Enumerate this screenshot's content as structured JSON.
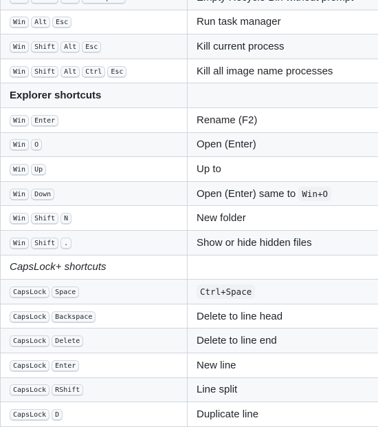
{
  "rows": [
    {
      "keys": [
        "Win",
        "Shift",
        "Alt",
        "Backspace"
      ],
      "desc": "Empty Recycle Bin without prompt"
    },
    {
      "keys": [
        "Win",
        "Alt",
        "Esc"
      ],
      "desc": "Run task manager"
    },
    {
      "keys": [
        "Win",
        "Shift",
        "Alt",
        "Esc"
      ],
      "desc": "Kill current process"
    },
    {
      "keys": [
        "Win",
        "Shift",
        "Alt",
        "Ctrl",
        "Esc"
      ],
      "desc": "Kill all image name processes"
    },
    {
      "section": "Explorer shortcuts",
      "style": "bold"
    },
    {
      "keys": [
        "Win",
        "Enter"
      ],
      "desc": "Rename (F2)"
    },
    {
      "keys": [
        "Win",
        "O"
      ],
      "desc": "Open (Enter)"
    },
    {
      "keys": [
        "Win",
        "Up"
      ],
      "desc": "Up to"
    },
    {
      "keys": [
        "Win",
        "Down"
      ],
      "desc": "Open (Enter) same to ",
      "code": "Win+O"
    },
    {
      "keys": [
        "Win",
        "Shift",
        "N"
      ],
      "desc": "New folder"
    },
    {
      "keys": [
        "Win",
        "Shift",
        "."
      ],
      "desc": "Show or hide hidden files"
    },
    {
      "section": "CapsLock+ shortcuts",
      "style": "italic"
    },
    {
      "keys": [
        "CapsLock",
        "Space"
      ],
      "desc": "",
      "code": "Ctrl+Space"
    },
    {
      "keys": [
        "CapsLock",
        "Backspace"
      ],
      "desc": "Delete to line head"
    },
    {
      "keys": [
        "CapsLock",
        "Delete"
      ],
      "desc": "Delete to line end"
    },
    {
      "keys": [
        "CapsLock",
        "Enter"
      ],
      "desc": "New line"
    },
    {
      "keys": [
        "CapsLock",
        "RShift"
      ],
      "desc": "Line split"
    },
    {
      "keys": [
        "CapsLock",
        "D"
      ],
      "desc": "Duplicate line"
    }
  ],
  "colors": {
    "border": "#d0d7de",
    "stripe": "#f6f8fa",
    "text": "#1f2328"
  }
}
